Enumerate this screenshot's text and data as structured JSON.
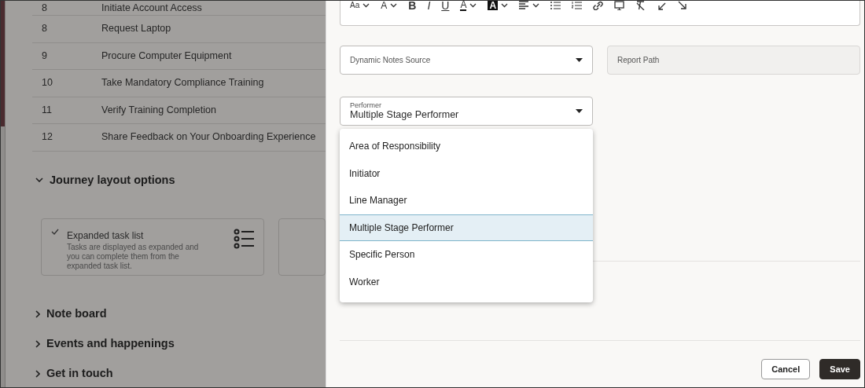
{
  "tasks": [
    {
      "number": "8",
      "name": "Initiate Account Access"
    },
    {
      "number": "8",
      "name": "Request Laptop"
    },
    {
      "number": "9",
      "name": "Procure Computer Equipment"
    },
    {
      "number": "10",
      "name": "Take Mandatory Compliance Training"
    },
    {
      "number": "11",
      "name": "Verify Training Completion"
    },
    {
      "number": "12",
      "name": "Share Feedback on Your Onboarding Experience"
    }
  ],
  "sections": [
    {
      "title": "Journey layout options",
      "expanded": true,
      "layout_cards": [
        {
          "title": "Expanded task list",
          "description": "Tasks are displayed as expanded and you can complete them from the expanded task list.",
          "selected": true
        },
        {
          "selected": false
        }
      ]
    },
    {
      "title": "Note board",
      "expanded": false
    },
    {
      "title": "Events and happenings",
      "expanded": false
    },
    {
      "title": "Get in touch",
      "expanded": false
    }
  ],
  "editor_toolbar": [
    {
      "kind": "font",
      "glyph": "Aa",
      "dropdown": true
    },
    {
      "kind": "size",
      "glyph": "A",
      "dropdown": true
    },
    {
      "kind": "bold",
      "glyph": "B",
      "dropdown": false
    },
    {
      "kind": "italic",
      "glyph": "I",
      "dropdown": false
    },
    {
      "kind": "underline",
      "glyph": "U",
      "dropdown": false
    },
    {
      "kind": "color",
      "glyph": "A",
      "dropdown": true
    },
    {
      "kind": "highlight",
      "glyph": "A",
      "dropdown": true
    },
    {
      "kind": "align",
      "dropdown": true
    },
    {
      "kind": "bullets",
      "dropdown": false
    },
    {
      "kind": "numbers",
      "dropdown": false
    },
    {
      "kind": "link",
      "dropdown": false
    },
    {
      "kind": "image",
      "dropdown": false
    },
    {
      "kind": "clear",
      "dropdown": false
    },
    {
      "kind": "undo",
      "dropdown": false
    },
    {
      "kind": "redo",
      "dropdown": false
    }
  ],
  "fields": [
    {
      "kind": "select",
      "label": "Dynamic Notes Source",
      "disabled": false
    },
    {
      "kind": "text",
      "label": "Report Path",
      "disabled": true
    }
  ],
  "performer": {
    "label": "Performer",
    "value": "Multiple Stage Performer",
    "options": [
      {
        "label": "Area of Responsibility",
        "selected": false
      },
      {
        "label": "Initiator",
        "selected": false
      },
      {
        "label": "Line Manager",
        "selected": false
      },
      {
        "label": "Multiple Stage Performer",
        "selected": true
      },
      {
        "label": "Specific Person",
        "selected": false
      },
      {
        "label": "Worker",
        "selected": false
      }
    ]
  },
  "buttons": [
    {
      "label": "Cancel",
      "kind": "secondary"
    },
    {
      "label": "Save",
      "kind": "primary"
    }
  ]
}
